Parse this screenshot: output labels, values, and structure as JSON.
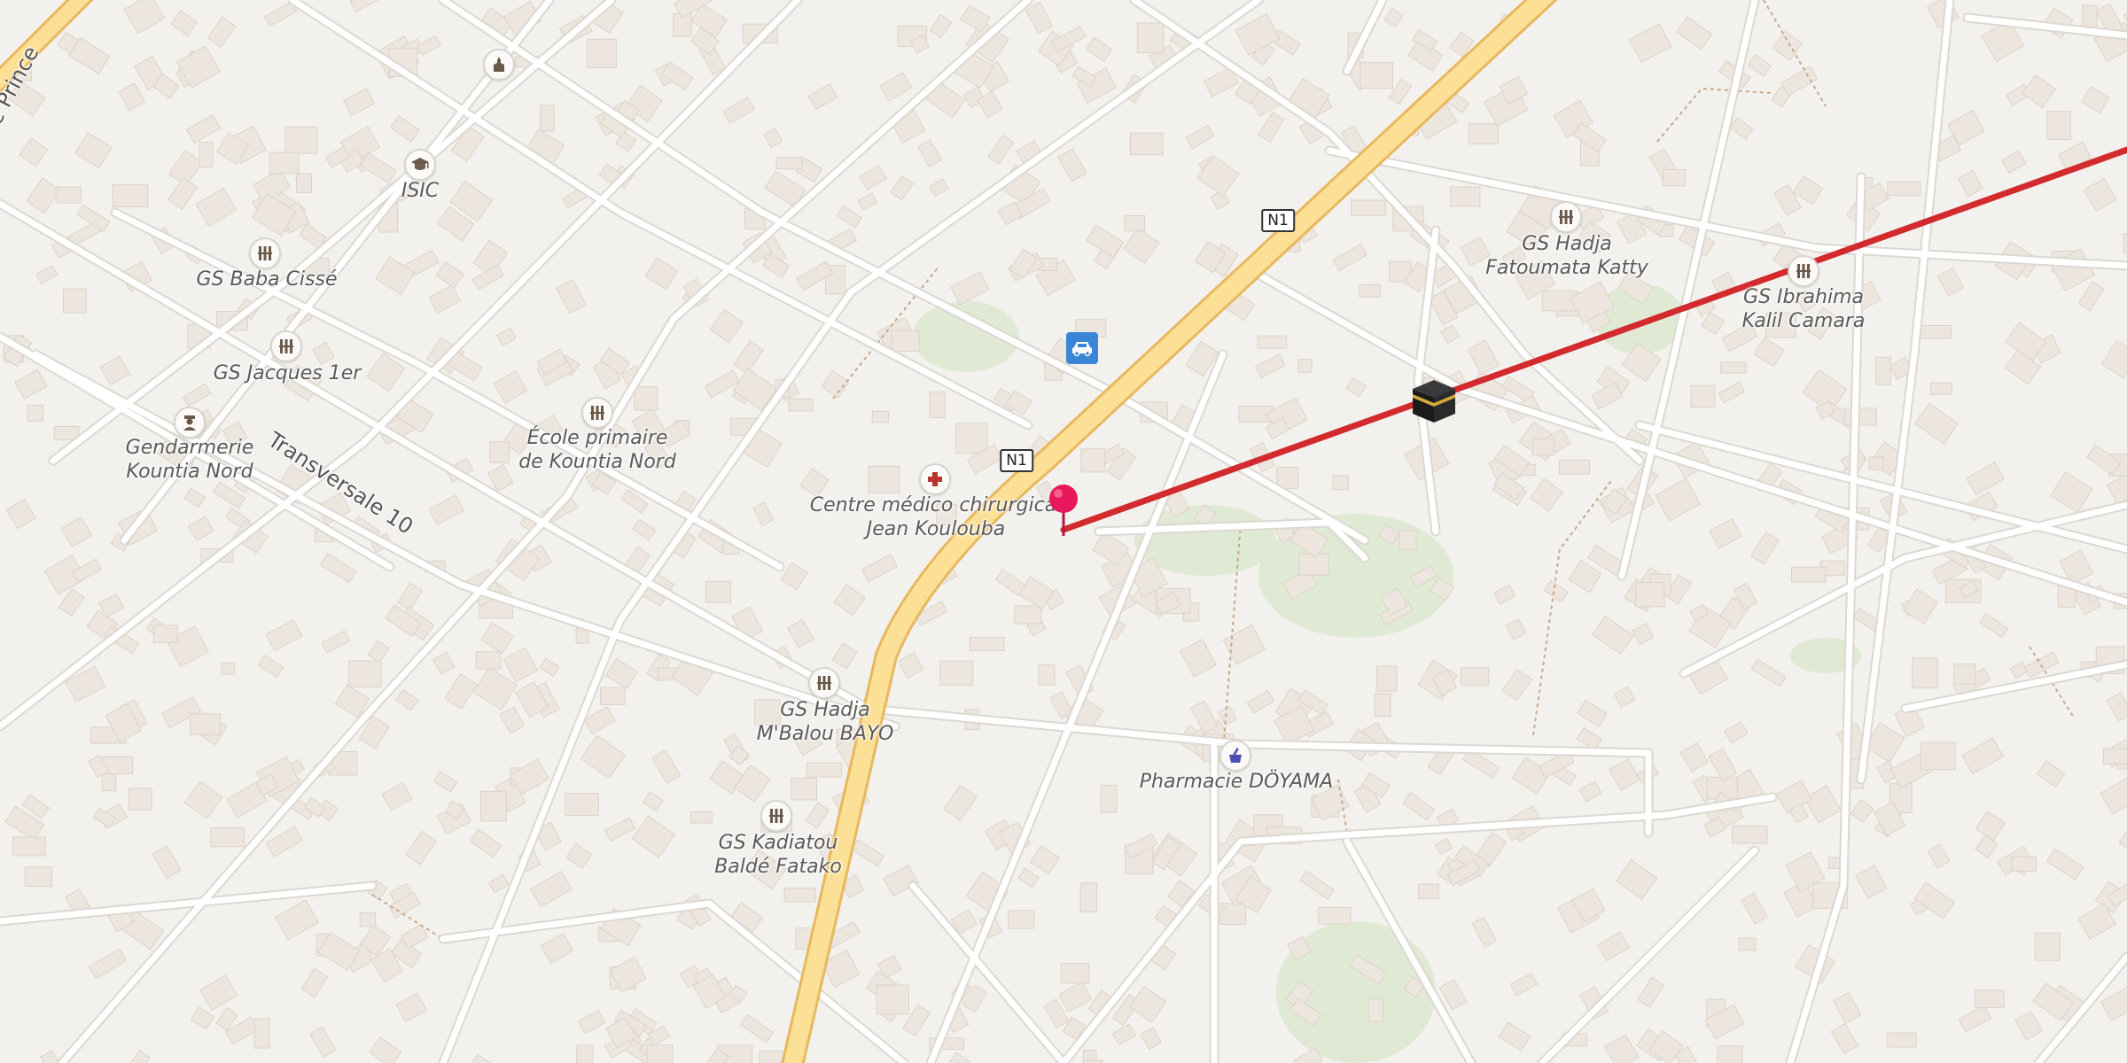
{
  "map": {
    "colors": {
      "background": "#f3f1ee",
      "road": "#ffffff",
      "road_casing": "#dcd8d2",
      "highway": "#fbe095",
      "highway_casing": "#e8b85f",
      "building": "#ece6df",
      "park": "#dfe9d3",
      "route_line": "#d32a2e",
      "pin": "#e8185c"
    },
    "road_labels": [
      {
        "id": "transversale-10",
        "text": "Transversale 10"
      },
      {
        "id": "prince",
        "text": "e Prince"
      }
    ],
    "shields": [
      {
        "id": "n1-upper",
        "text": "N1"
      },
      {
        "id": "n1-lower",
        "text": "N1"
      }
    ],
    "pois": [
      {
        "id": "isic",
        "label": "ISIC",
        "icon": "graduation-cap-icon"
      },
      {
        "id": "gs-baba-cisse",
        "label": "GS Baba Cissé",
        "icon": "school-icon"
      },
      {
        "id": "gs-jacques",
        "label": "GS Jacques 1er",
        "icon": "school-icon"
      },
      {
        "id": "gendarmerie",
        "label": "Gendarmerie\nKountia Nord",
        "icon": "police-icon"
      },
      {
        "id": "ecole-primaire",
        "label": "École primaire\nde Kountia Nord",
        "icon": "school-icon"
      },
      {
        "id": "centre-medico",
        "label": "Centre médico chirurgical\nJean Koulouba",
        "icon": "medical-cross-icon"
      },
      {
        "id": "gs-hadja-mbalou",
        "label": "GS Hadja\nM'Balou BAYO",
        "icon": "school-icon"
      },
      {
        "id": "gs-kadiatou",
        "label": "GS Kadiatou\nBaldé Fatako",
        "icon": "school-icon"
      },
      {
        "id": "pharmacie",
        "label": "Pharmacie DÖYAMA",
        "icon": "pharmacy-icon"
      },
      {
        "id": "gs-hadja-fatoumata",
        "label": "GS Hadja\nFatoumata Katty",
        "icon": "school-icon"
      },
      {
        "id": "gs-ibrahima",
        "label": "GS Ibrahima\nKalil Camara",
        "icon": "school-icon"
      },
      {
        "id": "church",
        "label": "",
        "icon": "place-of-worship-icon"
      }
    ],
    "markers": [
      {
        "id": "origin",
        "icon": "map-pin-icon"
      },
      {
        "id": "qibla-target",
        "icon": "kaaba-icon"
      },
      {
        "id": "parking",
        "icon": "car-parking-icon"
      }
    ]
  }
}
